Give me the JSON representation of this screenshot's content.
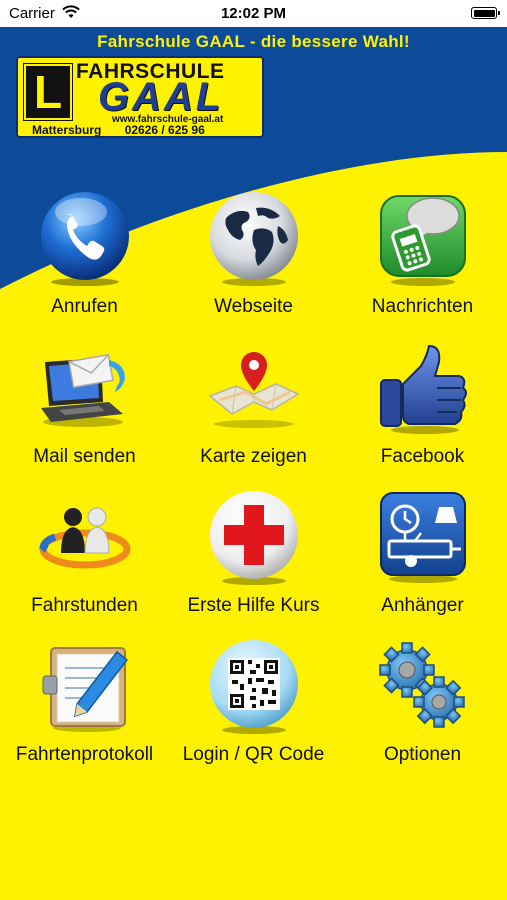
{
  "status_bar": {
    "carrier": "Carrier",
    "time": "12:02 PM"
  },
  "header": {
    "slogan": "Fahrschule GAAL - die bessere Wahl!",
    "logo": {
      "letter": "L",
      "title": "FAHRSCHULE",
      "brand": "GAAL",
      "url": "www.fahrschule-gaal.at",
      "city": "Mattersburg",
      "phone": "02626 / 625 96"
    }
  },
  "colors": {
    "brand_yellow": "#fef200",
    "brand_blue": "#0e4a9a"
  },
  "menu": [
    {
      "label": "Anrufen",
      "icon": "phone-icon"
    },
    {
      "label": "Webseite",
      "icon": "globe-icon"
    },
    {
      "label": "Nachrichten",
      "icon": "message-icon"
    },
    {
      "label": "Mail senden",
      "icon": "mail-laptop-icon"
    },
    {
      "label": "Karte zeigen",
      "icon": "map-pin-icon"
    },
    {
      "label": "Facebook",
      "icon": "thumbs-up-icon"
    },
    {
      "label": "Fahrstunden",
      "icon": "people-icon"
    },
    {
      "label": "Erste Hilfe Kurs",
      "icon": "red-cross-icon"
    },
    {
      "label": "Anhänger",
      "icon": "trailer-icon"
    },
    {
      "label": "Fahrtenprotokoll",
      "icon": "clipboard-pen-icon"
    },
    {
      "label": "Login / QR Code",
      "icon": "qr-code-icon"
    },
    {
      "label": "Optionen",
      "icon": "gears-icon"
    }
  ]
}
